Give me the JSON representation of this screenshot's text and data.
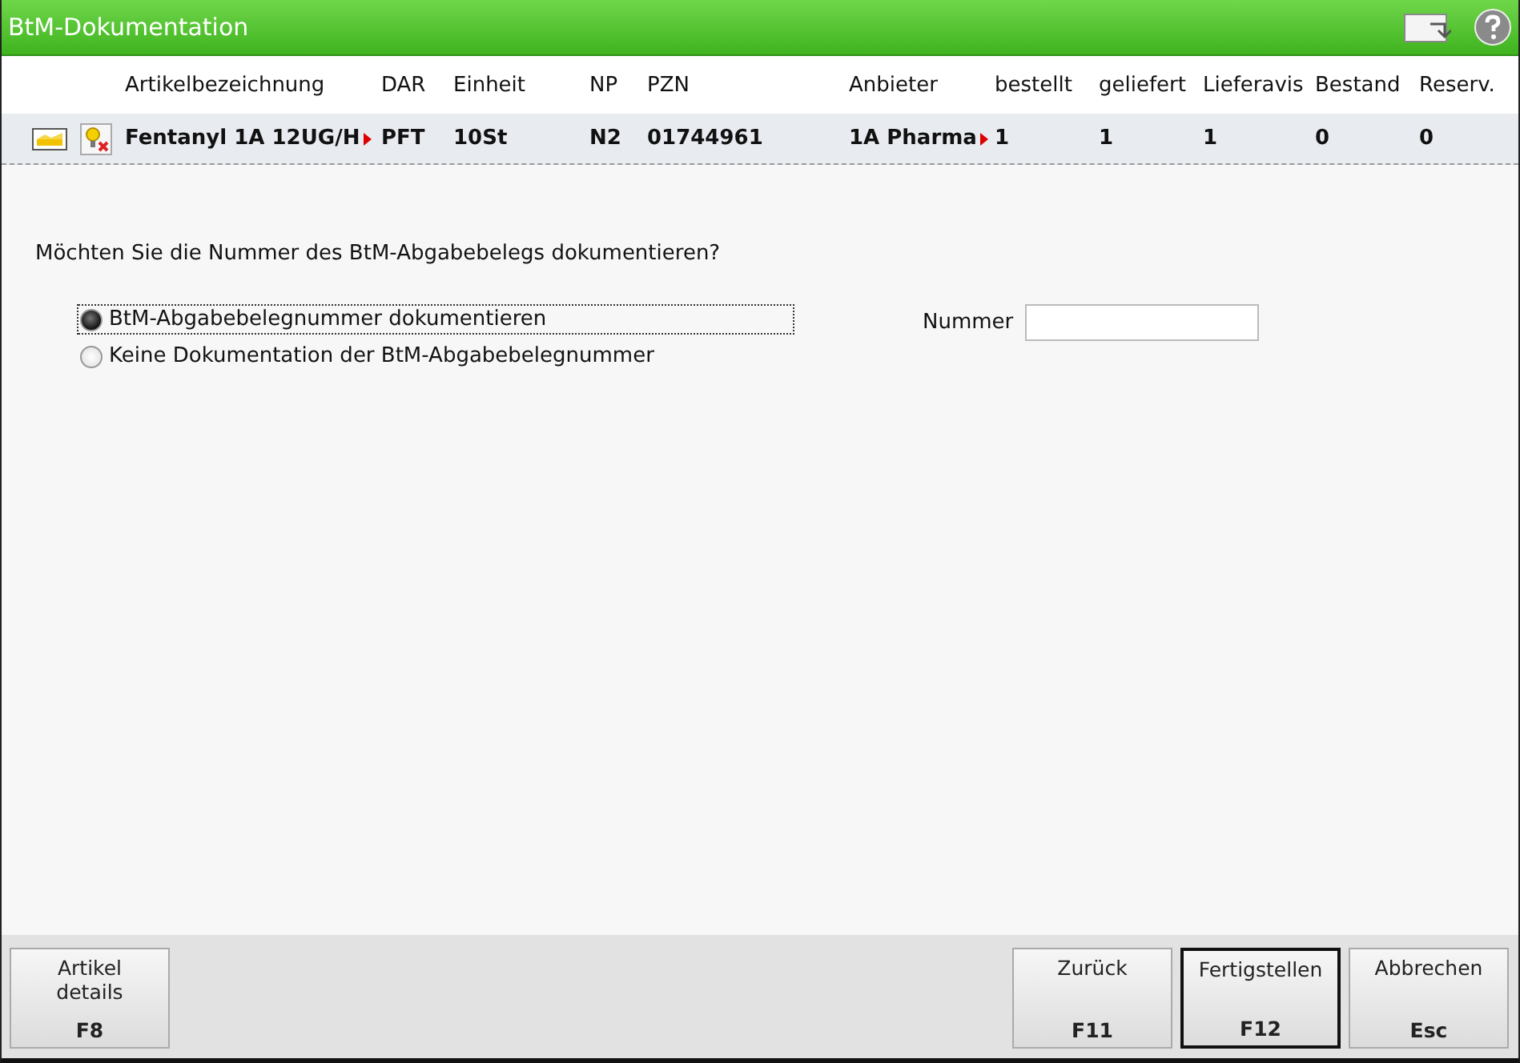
{
  "window": {
    "title": "BtM-Dokumentation"
  },
  "table": {
    "columns": [
      "Artikelbezeichnung",
      "DAR",
      "Einheit",
      "NP",
      "PZN",
      "Anbieter",
      "bestellt",
      "geliefert",
      "Lieferavis",
      "Bestand",
      "Reserv."
    ],
    "rows": [
      {
        "selected": true,
        "cells": [
          {
            "text": "Fentanyl 1A 12UG/H",
            "truncated": true
          },
          {
            "text": "PFT",
            "truncated": false
          },
          {
            "text": "10St",
            "truncated": false
          },
          {
            "text": "N2",
            "truncated": false
          },
          {
            "text": "01744961",
            "truncated": false
          },
          {
            "text": "1A Pharma",
            "truncated": true
          },
          {
            "text": "1",
            "truncated": false
          },
          {
            "text": "1",
            "truncated": false
          },
          {
            "text": "1",
            "truncated": false
          },
          {
            "text": "0",
            "truncated": false
          },
          {
            "text": "0",
            "truncated": false
          }
        ]
      }
    ]
  },
  "question": "Möchten Sie die Nummer des BtM-Abgabebelegs dokumentieren?",
  "options": [
    {
      "label": "BtM-Abgabebelegnummer dokumentieren",
      "selected": true,
      "focused": true
    },
    {
      "label": "Keine Dokumentation der BtM-Abgabebelegnummer",
      "selected": false,
      "focused": false
    }
  ],
  "number_field": {
    "label": "Nummer"
  },
  "buttons": [
    {
      "label": "Artikel details",
      "key": "F8",
      "default": false
    },
    {
      "label": "Zurück",
      "key": "F11",
      "default": false
    },
    {
      "label": "Fertigstellen",
      "key": "F12",
      "default": true
    },
    {
      "label": "Abbrechen",
      "key": "Esc",
      "default": false
    }
  ]
}
